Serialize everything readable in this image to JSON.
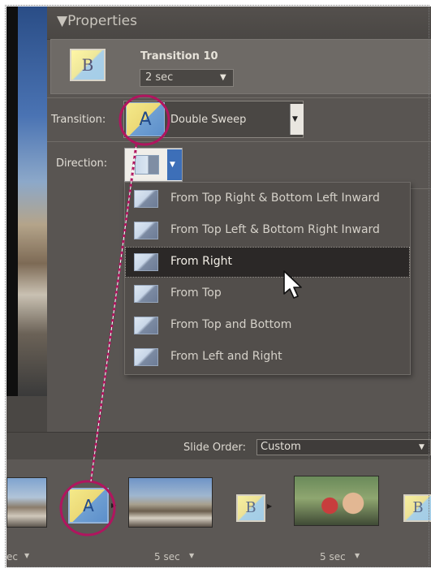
{
  "properties": {
    "header": "▼Properties",
    "thumbnail_glyph": "B",
    "transition_name": "Transition 10",
    "duration": "2 sec"
  },
  "transition": {
    "label": "Transition:",
    "icon_glyph": "A",
    "value": "Double Sweep"
  },
  "direction": {
    "label": "Direction:",
    "menu": [
      {
        "label": "From Top Right & Bottom Left Inward",
        "icon": "diagonal-inward-icon"
      },
      {
        "label": "From Top Left & Bottom Right Inward",
        "icon": "diagonal-inward-alt-icon"
      },
      {
        "label": "From Right",
        "icon": "from-right-icon",
        "selected": true
      },
      {
        "label": "From Top",
        "icon": "from-top-icon"
      },
      {
        "label": "From Top and Bottom",
        "icon": "from-top-bottom-icon"
      },
      {
        "label": "From Left and Right",
        "icon": "from-left-right-icon"
      }
    ]
  },
  "slide_order": {
    "label": "Slide Order:",
    "value": "Custom"
  },
  "filmstrip": {
    "durations": [
      "ec",
      "5 sec",
      "5 sec"
    ],
    "transition_a_glyph": "A",
    "transition_b_glyph": "B",
    "transition_b2_glyph": "B"
  },
  "colors": {
    "panel": "#595552",
    "menu": "#524e4b",
    "highlight_circle": "#b0155f",
    "dropdown_active": "#3d6fb8"
  }
}
